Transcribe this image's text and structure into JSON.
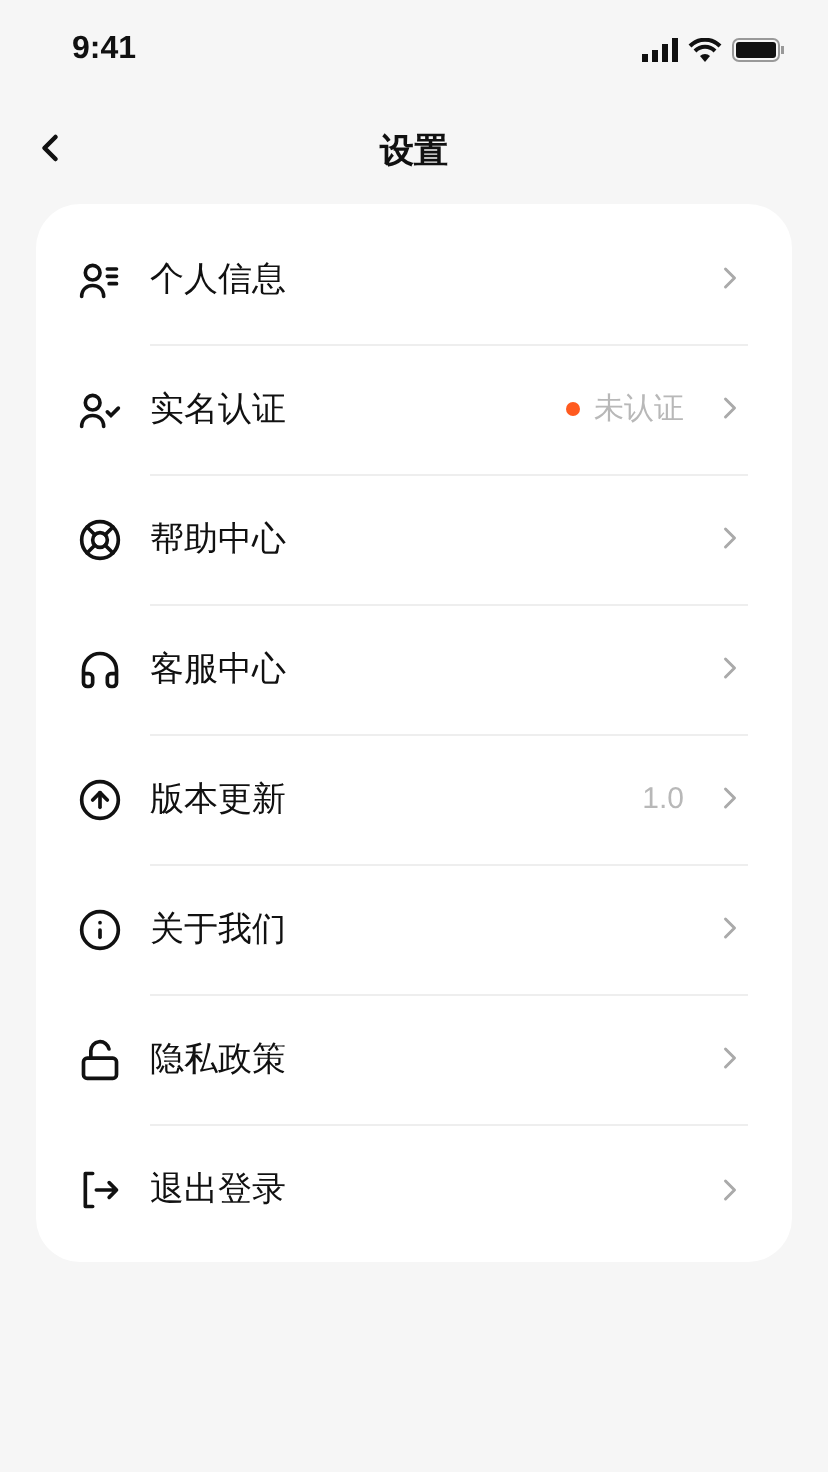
{
  "status_bar": {
    "time": "9:41"
  },
  "header": {
    "title": "设置"
  },
  "items": [
    {
      "label": "个人信息"
    },
    {
      "label": "实名认证",
      "status": {
        "text": "未认证",
        "color": "#ff5a1f"
      }
    },
    {
      "label": "帮助中心"
    },
    {
      "label": "客服中心"
    },
    {
      "label": "版本更新",
      "value": "1.0"
    },
    {
      "label": "关于我们"
    },
    {
      "label": "隐私政策"
    },
    {
      "label": "退出登录"
    }
  ]
}
